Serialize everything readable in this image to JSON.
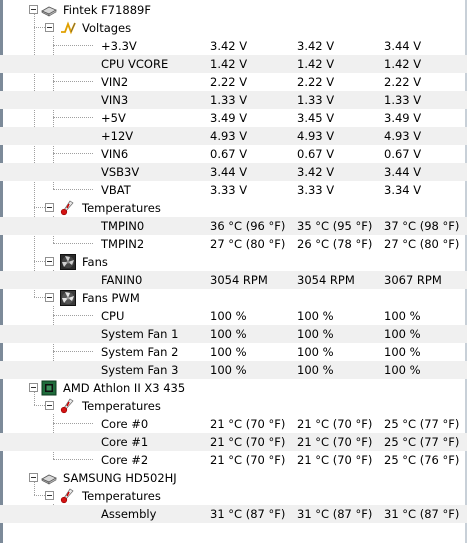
{
  "tree": [
    {
      "level": 0,
      "toggle": true,
      "icon": "hard-drive-icon",
      "label": "Fintek F71889F",
      "name": "node-fintek"
    },
    {
      "level": 1,
      "toggle": true,
      "icon": "voltage-icon",
      "label": "Voltages",
      "name": "group-voltages"
    },
    {
      "level": 2,
      "sensor": "+3.3V",
      "values": [
        "3.42 V",
        "3.42 V",
        "3.44 V"
      ]
    },
    {
      "level": 2,
      "sensor": "CPU VCORE",
      "values": [
        "1.42 V",
        "1.42 V",
        "1.42 V"
      ]
    },
    {
      "level": 2,
      "sensor": "VIN2",
      "values": [
        "2.22 V",
        "2.22 V",
        "2.22 V"
      ]
    },
    {
      "level": 2,
      "sensor": "VIN3",
      "values": [
        "1.33 V",
        "1.33 V",
        "1.33 V"
      ]
    },
    {
      "level": 2,
      "sensor": "+5V",
      "values": [
        "3.49 V",
        "3.45 V",
        "3.49 V"
      ]
    },
    {
      "level": 2,
      "sensor": "+12V",
      "values": [
        "4.93 V",
        "4.93 V",
        "4.93 V"
      ]
    },
    {
      "level": 2,
      "sensor": "VIN6",
      "values": [
        "0.67 V",
        "0.67 V",
        "0.67 V"
      ]
    },
    {
      "level": 2,
      "sensor": "VSB3V",
      "values": [
        "3.44 V",
        "3.42 V",
        "3.44 V"
      ]
    },
    {
      "level": 2,
      "sensor": "VBAT",
      "values": [
        "3.33 V",
        "3.33 V",
        "3.34 V"
      ]
    },
    {
      "level": 1,
      "toggle": true,
      "icon": "thermometer-icon",
      "label": "Temperatures",
      "name": "group-temperatures"
    },
    {
      "level": 2,
      "sensor": "TMPIN0",
      "values": [
        "36 °C  (96 °F)",
        "35 °C  (95 °F)",
        "37 °C  (98 °F)"
      ]
    },
    {
      "level": 2,
      "sensor": "TMPIN2",
      "values": [
        "27 °C  (80 °F)",
        "26 °C  (78 °F)",
        "27 °C  (80 °F)"
      ]
    },
    {
      "level": 1,
      "toggle": true,
      "icon": "fan-icon",
      "label": "Fans",
      "name": "group-fans"
    },
    {
      "level": 2,
      "sensor": "FANIN0",
      "values": [
        "3054 RPM",
        "3054 RPM",
        "3067 RPM"
      ]
    },
    {
      "level": 1,
      "toggle": true,
      "icon": "fan-pwm-icon",
      "label": "Fans PWM",
      "name": "group-fans-pwm"
    },
    {
      "level": 2,
      "sensor": "CPU",
      "values": [
        "100 %",
        "100 %",
        "100 %"
      ]
    },
    {
      "level": 2,
      "sensor": "System Fan 1",
      "values": [
        "100 %",
        "100 %",
        "100 %"
      ]
    },
    {
      "level": 2,
      "sensor": "System Fan 2",
      "values": [
        "100 %",
        "100 %",
        "100 %"
      ]
    },
    {
      "level": 2,
      "sensor": "System Fan 3",
      "values": [
        "100 %",
        "100 %",
        "100 %"
      ]
    },
    {
      "level": 0,
      "toggle": true,
      "icon": "cpu-chip-icon",
      "label": "AMD Athlon II X3 435",
      "name": "node-amd"
    },
    {
      "level": 1,
      "toggle": true,
      "icon": "thermometer-icon",
      "label": "Temperatures",
      "name": "group-temperatures"
    },
    {
      "level": 2,
      "sensor": "Core #0",
      "values": [
        "21 °C  (70 °F)",
        "21 °C  (70 °F)",
        "25 °C  (77 °F)"
      ]
    },
    {
      "level": 2,
      "sensor": "Core #1",
      "values": [
        "21 °C  (70 °F)",
        "21 °C  (70 °F)",
        "25 °C  (77 °F)"
      ]
    },
    {
      "level": 2,
      "sensor": "Core #2",
      "values": [
        "21 °C  (70 °F)",
        "21 °C  (70 °F)",
        "25 °C  (76 °F)"
      ]
    },
    {
      "level": 0,
      "toggle": true,
      "icon": "hard-drive-icon",
      "label": "SAMSUNG HD502HJ",
      "name": "node-samsung"
    },
    {
      "level": 1,
      "toggle": true,
      "icon": "thermometer-icon",
      "label": "Temperatures",
      "name": "group-temperatures"
    },
    {
      "level": 2,
      "sensor": "Assembly",
      "values": [
        "31 °C  (87 °F)",
        "31 °C  (87 °F)",
        "31 °C  (87 °F)"
      ]
    }
  ]
}
